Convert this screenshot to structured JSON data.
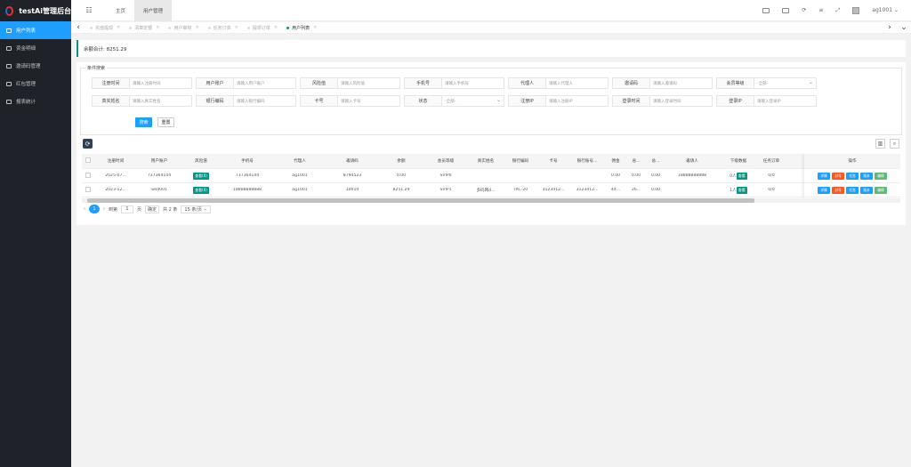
{
  "app": {
    "title": "testAi管理后台"
  },
  "sidebar": {
    "items": [
      {
        "label": "用户列表",
        "active": true
      },
      {
        "label": "资金明细"
      },
      {
        "label": "邀请码管理"
      },
      {
        "label": "红包管理"
      },
      {
        "label": "报表统计"
      }
    ]
  },
  "header": {
    "tabs": [
      {
        "label": "主页"
      },
      {
        "label": "用户管理",
        "active": true
      }
    ],
    "user": "ag1001"
  },
  "pagetabs": [
    {
      "label": "充值提现"
    },
    {
      "label": "清算定额"
    },
    {
      "label": "用户审核"
    },
    {
      "label": "任务订单"
    },
    {
      "label": "提现订单"
    },
    {
      "label": "用户列表",
      "active": true
    }
  ],
  "balance": {
    "text": "余额合计: 8251.29"
  },
  "search": {
    "legend": "条件搜索",
    "row1": [
      {
        "label": "注册时间",
        "placeholder": "请输入注册时间"
      },
      {
        "label": "用户账户",
        "placeholder": "请输入用户账户"
      },
      {
        "label": "风险值",
        "placeholder": "请输入风险值"
      },
      {
        "label": "手机号",
        "placeholder": "请输入手机号"
      },
      {
        "label": "代理人",
        "placeholder": "请输入代理人"
      },
      {
        "label": "邀请码",
        "placeholder": "请输入邀请码"
      },
      {
        "label": "会员等级",
        "placeholder": "-全部-",
        "select": true
      }
    ],
    "row2": [
      {
        "label": "真实姓名",
        "placeholder": "请输入真实姓名"
      },
      {
        "label": "银行编码",
        "placeholder": "请输入银行编码"
      },
      {
        "label": "卡号",
        "placeholder": "请输入卡号"
      },
      {
        "label": "状态",
        "placeholder": "-全部-",
        "select": true
      },
      {
        "label": "注册IP",
        "placeholder": "请输入注册IP"
      },
      {
        "label": "登录时间",
        "placeholder": "请输入登录时间"
      },
      {
        "label": "登录IP",
        "placeholder": "请输入登录IP"
      }
    ],
    "search_label": "搜索",
    "reset_label": "重置"
  },
  "table": {
    "headers": [
      "注册时间",
      "用户账户",
      "风险值",
      "手机号",
      "代理人",
      "邀请码",
      "余额",
      "会员等级",
      "真实姓名",
      "银行编码",
      "卡号",
      "银行账号...",
      "佣金",
      "总...",
      "总...",
      "邀请人",
      "下级数据",
      "任务订单",
      "操作"
    ],
    "rows": [
      [
        "2025-07...",
        "737364144",
        "查看(0)",
        "737364144",
        "ag1001",
        "8794523",
        "0.00",
        "SVIP0",
        "",
        "",
        "",
        "",
        "0.00",
        "0.00",
        "0.00",
        "18888888888",
        "0人",
        "0/0"
      ],
      [
        "2023-12...",
        "wsd001",
        "查看(0)",
        "18888888888",
        "ag1001",
        "10010",
        "8251.29",
        "SVIP1",
        "多码网d...",
        "TRC-20",
        "3123412...",
        "3123412...",
        "44...",
        "26...",
        "0.00",
        "",
        "1人",
        "0/0"
      ]
    ],
    "sub_label": "查看",
    "actions": [
      "详情",
      "封号",
      "任务",
      "账本",
      "编辑"
    ]
  },
  "pager": {
    "prev": "‹",
    "current": "1",
    "next": "›",
    "goto_label": "到第",
    "page_value": "1",
    "page_suffix": "页",
    "confirm": "确定",
    "total": "共 2 条",
    "per_page": "15 条/页"
  }
}
